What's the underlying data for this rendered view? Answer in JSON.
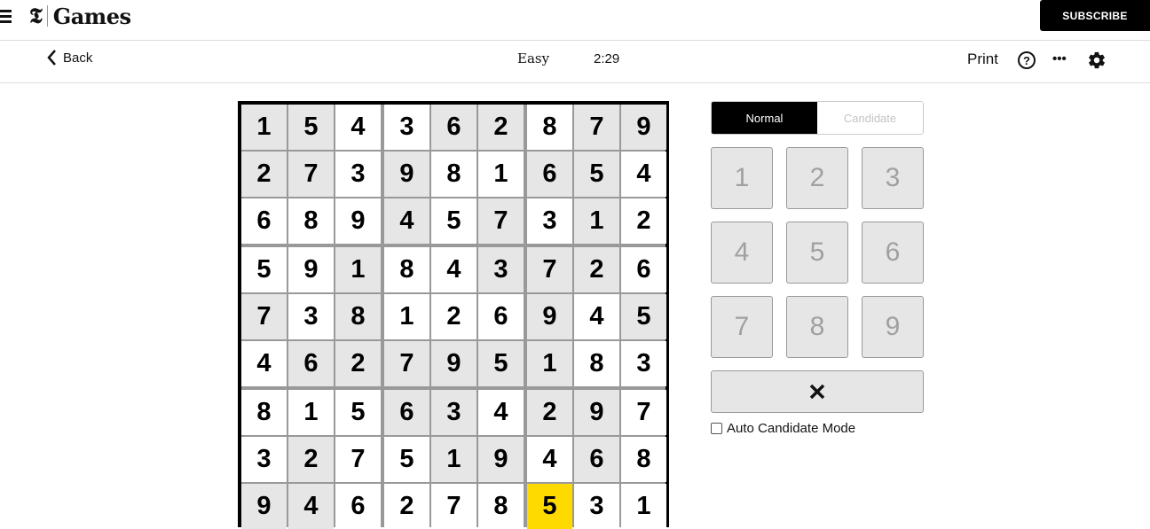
{
  "header": {
    "logo_mark": "𝕿",
    "logo_text": "Games",
    "subscribe_label": "SUBSCRIBE"
  },
  "toolbar": {
    "back_label": "Back",
    "level": "Easy",
    "timer": "2:29",
    "print_label": "Print",
    "help_label": "?",
    "more_label": "•••"
  },
  "board": {
    "cells": [
      [
        {
          "v": "1",
          "t": "prefilled"
        },
        {
          "v": "5",
          "t": "prefilled"
        },
        {
          "v": "4",
          "t": "user"
        },
        {
          "v": "3",
          "t": "user"
        },
        {
          "v": "6",
          "t": "prefilled"
        },
        {
          "v": "2",
          "t": "prefilled"
        },
        {
          "v": "8",
          "t": "user"
        },
        {
          "v": "7",
          "t": "prefilled"
        },
        {
          "v": "9",
          "t": "prefilled"
        }
      ],
      [
        {
          "v": "2",
          "t": "prefilled"
        },
        {
          "v": "7",
          "t": "prefilled"
        },
        {
          "v": "3",
          "t": "user"
        },
        {
          "v": "9",
          "t": "prefilled"
        },
        {
          "v": "8",
          "t": "user"
        },
        {
          "v": "1",
          "t": "user"
        },
        {
          "v": "6",
          "t": "prefilled"
        },
        {
          "v": "5",
          "t": "prefilled"
        },
        {
          "v": "4",
          "t": "user"
        }
      ],
      [
        {
          "v": "6",
          "t": "user"
        },
        {
          "v": "8",
          "t": "user"
        },
        {
          "v": "9",
          "t": "user"
        },
        {
          "v": "4",
          "t": "prefilled"
        },
        {
          "v": "5",
          "t": "user"
        },
        {
          "v": "7",
          "t": "prefilled"
        },
        {
          "v": "3",
          "t": "user"
        },
        {
          "v": "1",
          "t": "prefilled"
        },
        {
          "v": "2",
          "t": "user"
        }
      ],
      [
        {
          "v": "5",
          "t": "user"
        },
        {
          "v": "9",
          "t": "user"
        },
        {
          "v": "1",
          "t": "prefilled"
        },
        {
          "v": "8",
          "t": "user"
        },
        {
          "v": "4",
          "t": "user"
        },
        {
          "v": "3",
          "t": "prefilled"
        },
        {
          "v": "7",
          "t": "prefilled"
        },
        {
          "v": "2",
          "t": "prefilled"
        },
        {
          "v": "6",
          "t": "user"
        }
      ],
      [
        {
          "v": "7",
          "t": "prefilled"
        },
        {
          "v": "3",
          "t": "user"
        },
        {
          "v": "8",
          "t": "prefilled"
        },
        {
          "v": "1",
          "t": "user"
        },
        {
          "v": "2",
          "t": "user"
        },
        {
          "v": "6",
          "t": "user"
        },
        {
          "v": "9",
          "t": "prefilled"
        },
        {
          "v": "4",
          "t": "user"
        },
        {
          "v": "5",
          "t": "prefilled"
        }
      ],
      [
        {
          "v": "4",
          "t": "user"
        },
        {
          "v": "6",
          "t": "prefilled"
        },
        {
          "v": "2",
          "t": "prefilled"
        },
        {
          "v": "7",
          "t": "prefilled"
        },
        {
          "v": "9",
          "t": "prefilled"
        },
        {
          "v": "5",
          "t": "prefilled"
        },
        {
          "v": "1",
          "t": "prefilled"
        },
        {
          "v": "8",
          "t": "user"
        },
        {
          "v": "3",
          "t": "user"
        }
      ],
      [
        {
          "v": "8",
          "t": "user"
        },
        {
          "v": "1",
          "t": "user"
        },
        {
          "v": "5",
          "t": "user"
        },
        {
          "v": "6",
          "t": "prefilled"
        },
        {
          "v": "3",
          "t": "prefilled"
        },
        {
          "v": "4",
          "t": "user"
        },
        {
          "v": "2",
          "t": "prefilled"
        },
        {
          "v": "9",
          "t": "prefilled"
        },
        {
          "v": "7",
          "t": "user"
        }
      ],
      [
        {
          "v": "3",
          "t": "user"
        },
        {
          "v": "2",
          "t": "prefilled"
        },
        {
          "v": "7",
          "t": "user"
        },
        {
          "v": "5",
          "t": "user"
        },
        {
          "v": "1",
          "t": "prefilled"
        },
        {
          "v": "9",
          "t": "prefilled"
        },
        {
          "v": "4",
          "t": "user"
        },
        {
          "v": "6",
          "t": "prefilled"
        },
        {
          "v": "8",
          "t": "user"
        }
      ],
      [
        {
          "v": "9",
          "t": "prefilled"
        },
        {
          "v": "4",
          "t": "prefilled"
        },
        {
          "v": "6",
          "t": "user"
        },
        {
          "v": "2",
          "t": "user"
        },
        {
          "v": "7",
          "t": "user"
        },
        {
          "v": "8",
          "t": "user"
        },
        {
          "v": "5",
          "t": "selected"
        },
        {
          "v": "3",
          "t": "user"
        },
        {
          "v": "1",
          "t": "user"
        }
      ]
    ],
    "selected_color": "#ffda00",
    "prefilled_color": "#e6e6e6"
  },
  "panel": {
    "mode_normal": "Normal",
    "mode_candidate": "Candidate",
    "active_mode": "Normal",
    "keys": [
      "1",
      "2",
      "3",
      "4",
      "5",
      "6",
      "7",
      "8",
      "9"
    ],
    "erase_label": "✕",
    "auto_candidate_label": "Auto Candidate Mode",
    "auto_candidate_checked": false
  }
}
